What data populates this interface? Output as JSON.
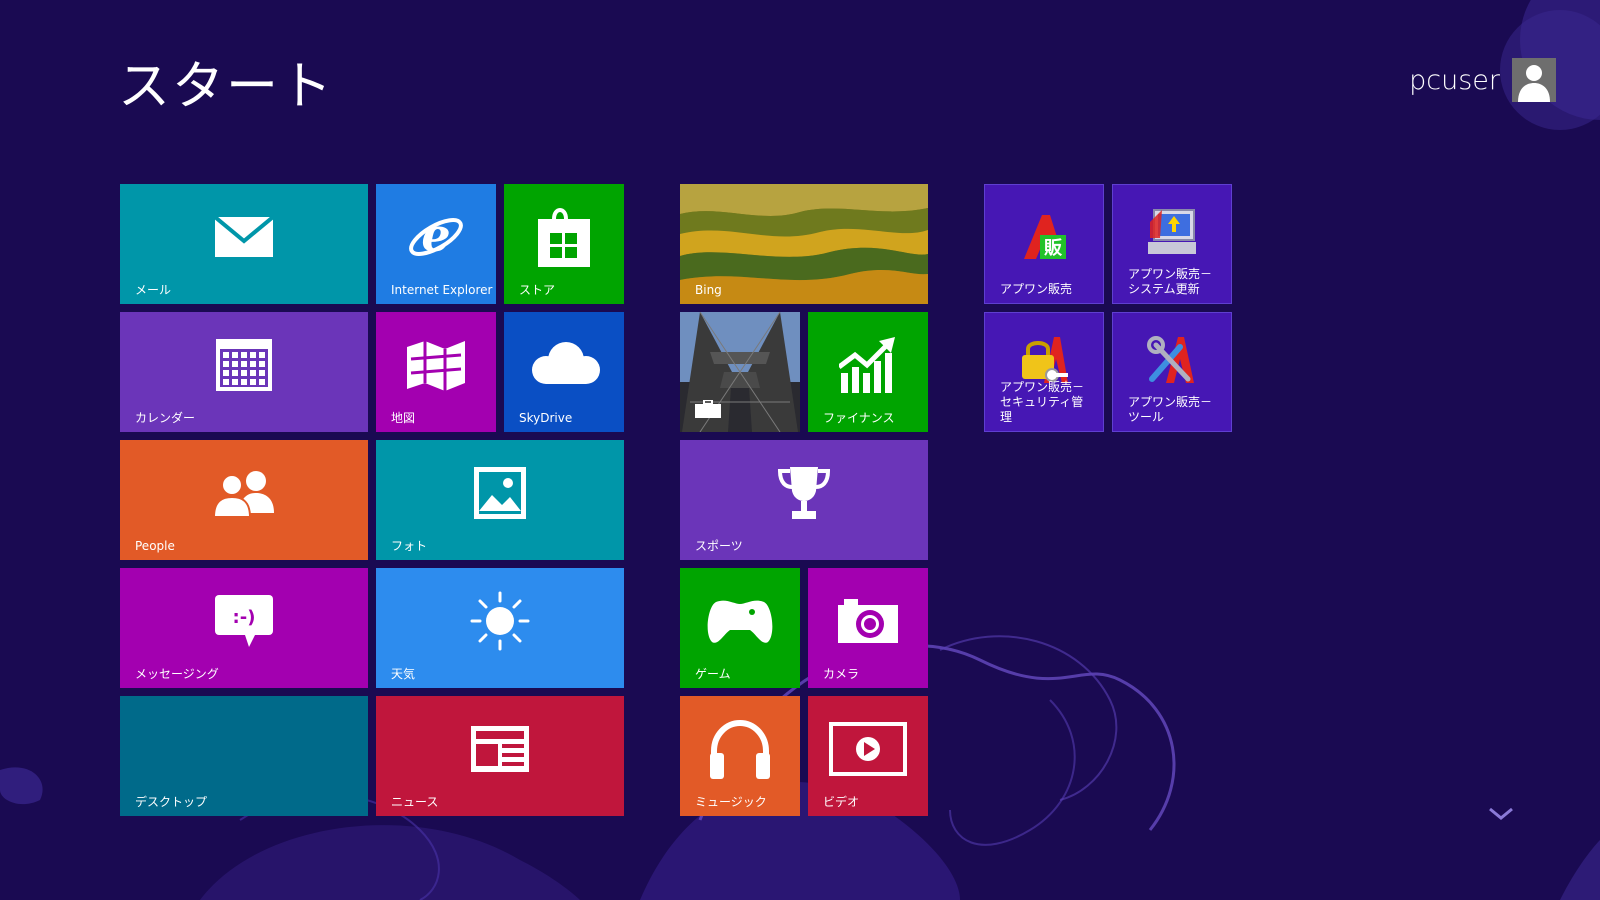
{
  "screen": {
    "title": "スタート"
  },
  "user": {
    "name": "pcuser"
  },
  "tiles": {
    "mail": {
      "label": "メール",
      "color": "#0096a9"
    },
    "ie": {
      "label": "Internet Explorer",
      "color": "#1f7ce3"
    },
    "store": {
      "label": "ストア",
      "color": "#00a400"
    },
    "bing": {
      "label": "Bing"
    },
    "app_sales": {
      "label": "アプワン販売",
      "color": "#4617b4"
    },
    "app_update": {
      "label": "アプワン販売－システム更新",
      "color": "#4617b4"
    },
    "calendar": {
      "label": "カレンダー",
      "color": "#6b35b9"
    },
    "maps": {
      "label": "地図",
      "color": "#a300b0"
    },
    "skydrive": {
      "label": "SkyDrive",
      "color": "#0a4fc4"
    },
    "travel": {
      "label": ""
    },
    "finance": {
      "label": "ファイナンス",
      "color": "#00a400"
    },
    "app_security": {
      "label": "アプワン販売－セキュリティ管理",
      "color": "#4617b4"
    },
    "app_tools": {
      "label": "アプワン販売－ツール",
      "color": "#4617b4"
    },
    "people": {
      "label": "People",
      "color": "#e25a27"
    },
    "photos": {
      "label": "フォト",
      "color": "#0096a9"
    },
    "sports": {
      "label": "スポーツ",
      "color": "#6b35b9"
    },
    "messaging": {
      "label": "メッセージング",
      "color": "#a300b0"
    },
    "weather": {
      "label": "天気",
      "color": "#2d8cee"
    },
    "games": {
      "label": "ゲーム",
      "color": "#00a400"
    },
    "camera": {
      "label": "カメラ",
      "color": "#a300b0"
    },
    "desktop": {
      "label": "デスクトップ",
      "color": "#006a8a"
    },
    "news": {
      "label": "ニュース",
      "color": "#c0163c"
    },
    "music": {
      "label": "ミュージック",
      "color": "#e25a27"
    },
    "video": {
      "label": "ビデオ",
      "color": "#c0163c"
    }
  },
  "icons": {
    "mail": "envelope-icon",
    "ie": "internet-explorer-icon",
    "store": "store-bag-icon",
    "calendar": "calendar-icon",
    "maps": "map-icon",
    "skydrive": "cloud-icon",
    "finance": "chart-up-icon",
    "people": "people-icon",
    "photos": "photo-icon",
    "sports": "trophy-icon",
    "messaging": "speech-bubble-icon",
    "weather": "sun-icon",
    "games": "gamepad-icon",
    "camera": "camera-icon",
    "news": "newspaper-icon",
    "music": "headphones-icon",
    "video": "play-icon",
    "chevron": "chevron-down-icon"
  }
}
